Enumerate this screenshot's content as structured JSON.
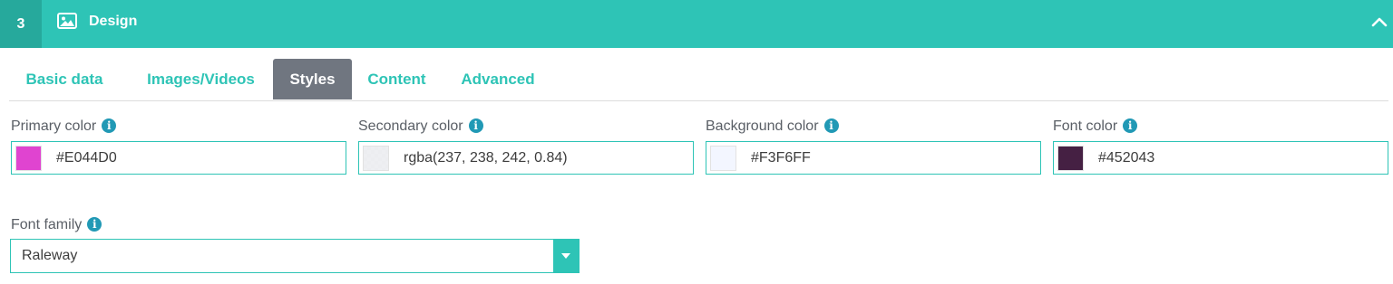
{
  "section": {
    "step_number": "3",
    "title": "Design",
    "title_icon": "image-icon",
    "collapse_icon": "chevron-up-icon"
  },
  "tabs": [
    {
      "label": "Basic data",
      "active": false
    },
    {
      "label": "Images/Videos",
      "active": false
    },
    {
      "label": "Styles",
      "active": true
    },
    {
      "label": "Content",
      "active": false
    },
    {
      "label": "Advanced",
      "active": false
    }
  ],
  "colors": {
    "primary": {
      "label": "Primary color",
      "value": "#E044D0",
      "swatch": "#E044D0"
    },
    "secondary": {
      "label": "Secondary color",
      "value": "rgba(237, 238, 242, 0.84)",
      "swatch": "rgba(237,238,242,0.84)"
    },
    "background": {
      "label": "Background color",
      "value": "#F3F6FF",
      "swatch": "#F3F6FF"
    },
    "font": {
      "label": "Font color",
      "value": "#452043",
      "swatch": "#452043"
    }
  },
  "font_family": {
    "label": "Font family",
    "value": "Raleway"
  },
  "theme": {
    "accent": "#2ec4b6",
    "accent_dark": "#26a99c",
    "active_tab": "#707680",
    "info_icon": "#2199b5"
  }
}
